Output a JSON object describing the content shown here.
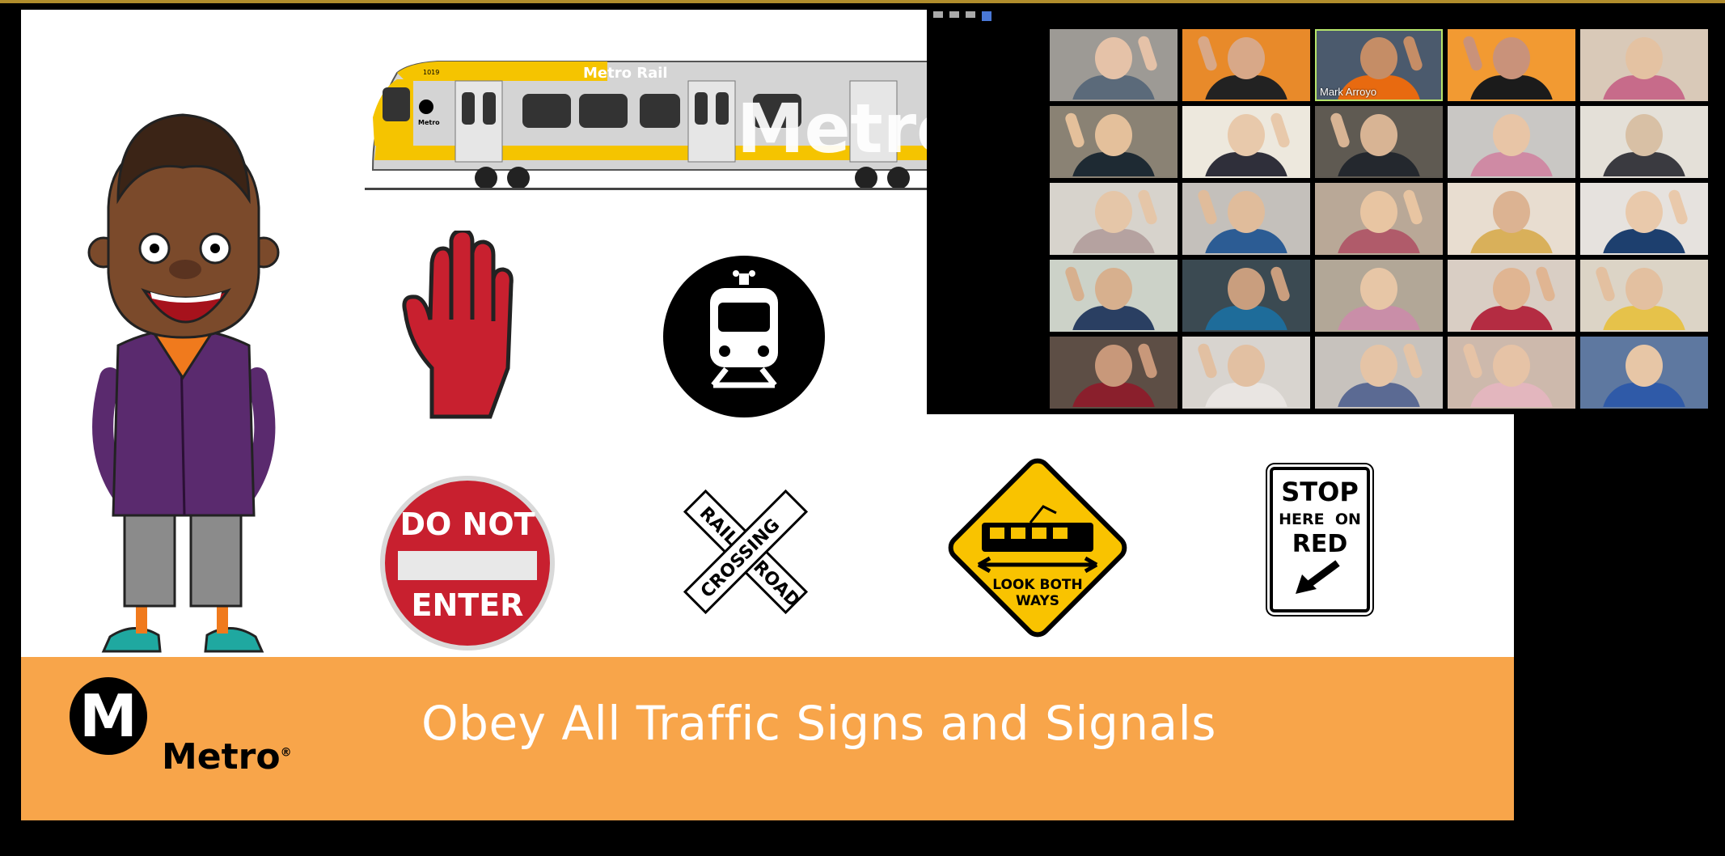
{
  "slide": {
    "title": "Obey All Traffic Signs and Signals",
    "brand": "Metro",
    "logo_letter": "M",
    "train_roof_label": "Metro Rail",
    "train_side_text": "Metro",
    "train_number": "1019",
    "train_logo_text": "Metro",
    "signs": {
      "do_not": "DO NOT",
      "enter": "ENTER",
      "rail": "RAIL",
      "road": "ROAD",
      "crossing": "CROSSING",
      "look_both": "LOOK BOTH",
      "ways": "WAYS",
      "stop_1": "STOP",
      "stop_2": "HERE  ON",
      "stop_3": "RED"
    },
    "colors": {
      "banner": "#f8a54a",
      "train_yellow": "#f5c400",
      "sign_red": "#c8202f",
      "warning_yellow": "#f9c300"
    }
  },
  "meeting": {
    "participants": [
      {
        "name": "",
        "bg": "#9d9a95",
        "shirt": "#5b6a7a",
        "skin": "#e5c2a8",
        "wave": true
      },
      {
        "name": "",
        "bg": "#e88a2a",
        "shirt": "#222222",
        "skin": "#d8a888",
        "wave": true
      },
      {
        "name": "Mark Arroyo",
        "bg": "#4b5a6d",
        "shirt": "#e86a10",
        "skin": "#c58d66",
        "wave": true,
        "active": true
      },
      {
        "name": "",
        "bg": "#f29a32",
        "shirt": "#1b1b1b",
        "skin": "#c9927a",
        "wave": true
      },
      {
        "name": "",
        "bg": "#d9c9b8",
        "shirt": "#c76b8a",
        "skin": "#e4c2a2",
        "wave": false
      },
      {
        "name": "",
        "bg": "#8a8274",
        "shirt": "#1e2a33",
        "skin": "#e4c09b",
        "wave": true
      },
      {
        "name": "",
        "bg": "#ede8dd",
        "shirt": "#2f2f3a",
        "skin": "#e8c9ab",
        "wave": true
      },
      {
        "name": "",
        "bg": "#5f5a52",
        "shirt": "#24282e",
        "skin": "#d8b494",
        "wave": true
      },
      {
        "name": "",
        "bg": "#c9c7c4",
        "shirt": "#cf8aa4",
        "skin": "#e8c5a6",
        "wave": false
      },
      {
        "name": "",
        "bg": "#e4e0d8",
        "shirt": "#3a3a40",
        "skin": "#d8c0a5",
        "wave": false
      },
      {
        "name": "",
        "bg": "#d7d3cc",
        "shirt": "#b5a2a0",
        "skin": "#e5c6a8",
        "wave": true
      },
      {
        "name": "",
        "bg": "#c4c0bb",
        "shirt": "#2c5c94",
        "skin": "#e0bc9b",
        "wave": true
      },
      {
        "name": "",
        "bg": "#b9a897",
        "shirt": "#b05b6a",
        "skin": "#e8c5a2",
        "wave": true
      },
      {
        "name": "",
        "bg": "#e8ddd0",
        "shirt": "#d9b05a",
        "skin": "#dcb392",
        "wave": false
      },
      {
        "name": "",
        "bg": "#e6e2de",
        "shirt": "#1d3f6e",
        "skin": "#e9c9ab",
        "wave": true
      },
      {
        "name": "",
        "bg": "#ccd2c8",
        "shirt": "#2a3f62",
        "skin": "#d7b08e",
        "wave": true
      },
      {
        "name": "",
        "bg": "#3b4a52",
        "shirt": "#1e6c9a",
        "skin": "#c99e7e",
        "wave": true
      },
      {
        "name": "",
        "bg": "#b2a797",
        "shirt": "#c98ea8",
        "skin": "#e7c6a6",
        "wave": false
      },
      {
        "name": "",
        "bg": "#d9cec4",
        "shirt": "#b42c42",
        "skin": "#e0b592",
        "wave": true
      },
      {
        "name": "",
        "bg": "#dcd4c6",
        "shirt": "#e6c24a",
        "skin": "#e3c0a0",
        "wave": true
      },
      {
        "name": "",
        "bg": "#5d4e45",
        "shirt": "#8a1f2c",
        "skin": "#c8987a",
        "wave": true
      },
      {
        "name": "",
        "bg": "#d8d4cf",
        "shirt": "#e9e5e2",
        "skin": "#e2c0a2",
        "wave": true
      },
      {
        "name": "",
        "bg": "#c7c2bd",
        "shirt": "#5b6a93",
        "skin": "#e5c4a6",
        "wave": true
      },
      {
        "name": "",
        "bg": "#cdb9ac",
        "shirt": "#e3b6be",
        "skin": "#e6c3a6",
        "wave": true
      },
      {
        "name": "",
        "bg": "#5e78a0",
        "shirt": "#2f5aa8",
        "skin": "#e7c6a6",
        "wave": false
      }
    ]
  }
}
